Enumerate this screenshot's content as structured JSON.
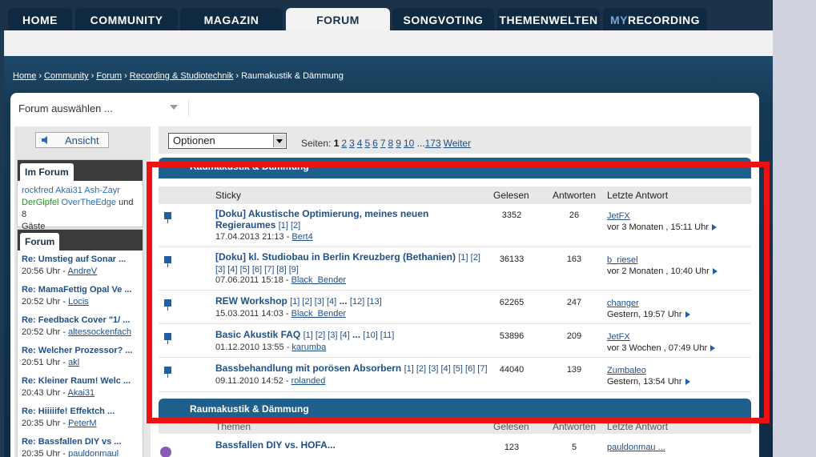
{
  "nav": {
    "tabs": [
      {
        "label": "HOME"
      },
      {
        "label": "COMMUNITY"
      },
      {
        "label": "MAGAZIN"
      },
      {
        "label": "FORUM"
      },
      {
        "label": "SONGVOTING"
      },
      {
        "label": "THEMENWELTEN"
      },
      {
        "prefix": "My",
        "label": "RECORDING"
      }
    ],
    "active": "FORUM"
  },
  "breadcrumb": {
    "items": [
      "Home",
      "Community",
      "Forum",
      "Recording & Studiotechnik"
    ],
    "current": "Raumakustik & Dämmung",
    "separator": "›"
  },
  "forum_select": {
    "label": "Forum auswählen ..."
  },
  "sidebar": {
    "ansicht_label": "Ansicht",
    "im_forum": {
      "title": "Im Forum",
      "users_line1": "rockfred Akai31 Ash-Zayr",
      "user_green": "DerGipfel",
      "user_after": "OverTheEdge",
      "and_text": "und 8",
      "guests": "Gäste"
    },
    "forum_box": {
      "title": "Forum",
      "items": [
        {
          "title": "Re: Umstieg auf Sonar ...",
          "time": "20:56 Uhr -",
          "user": "AndreV"
        },
        {
          "title": "Re: MamaFettig Opal Ve ...",
          "time": "20:52 Uhr -",
          "user": "Locis"
        },
        {
          "title": "Re: Feedback Cover \"1/ ...",
          "time": "20:52 Uhr -",
          "user": "altessockenfach"
        },
        {
          "title": "Re: Welcher Prozessor? ...",
          "time": "20:51 Uhr -",
          "user": "akl"
        },
        {
          "title": "Re: Kleiner Raum! Welc ...",
          "time": "20:43 Uhr -",
          "user": "Akai31"
        },
        {
          "title": "Re: Hiiiiife! Effektch ...",
          "time": "20:35 Uhr -",
          "user": "PeterM"
        },
        {
          "title": "Re: Bassfallen DIY vs ...",
          "time": "20:35 Uhr -",
          "user": "pauldonmaul"
        }
      ]
    }
  },
  "toolbar": {
    "options_label": "Optionen",
    "pages_label": "Seiten:",
    "current_page": "1",
    "pages": [
      "2",
      "3",
      "4",
      "5",
      "6",
      "7",
      "8",
      "9",
      "10"
    ],
    "ellipsis": "...",
    "last_page": "173",
    "next_label": "Weiter"
  },
  "section1": {
    "title": "Raumakustik & Dämmung",
    "columns": {
      "topic": "Sticky",
      "views": "Gelesen",
      "replies": "Antworten",
      "last": "Letzte Antwort"
    },
    "rows": [
      {
        "title_line1": "[Doku] Akustische Optimierung, meines neuen",
        "title_line2": "Regieraumes",
        "pages": "[1] [2]",
        "date": "17.04.2013 21:13 -",
        "author": "Bert4",
        "views": "3352",
        "replies": "26",
        "last_user": "JetFX",
        "last_time": "vor 3 Monaten , 15:11 Uhr"
      },
      {
        "title_line1": "[Doku] kl. Studiobau in Berlin Kreuzberg (Bethanien)",
        "pages_inline": "[1] [2]",
        "pages": "[3] [4] [5] [6] [7] [8] [9]",
        "date": "07.06.2011 15:18 -",
        "author": "Black_Bender",
        "views": "36133",
        "replies": "163",
        "last_user": "b_riesel",
        "last_time": "vor 2 Monaten , 10:40 Uhr"
      },
      {
        "title_line1": "REW Workshop",
        "pages": "[1] [2] [3] [4]",
        "ellipsis": "...",
        "pages_end": "[12] [13]",
        "date": "15.03.2011 14:03 -",
        "author": "Black_Bender",
        "views": "62265",
        "replies": "247",
        "last_user": "changer",
        "last_time": "Gestern, 19:57 Uhr"
      },
      {
        "title_line1": "Basic Akustik FAQ",
        "pages": "[1] [2] [3] [4]",
        "ellipsis": "...",
        "pages_end": "[10] [11]",
        "date": "01.12.2010 13:55 -",
        "author": "karumba",
        "views": "53896",
        "replies": "209",
        "last_user": "JetFX",
        "last_time": "vor 3 Wochen , 07:49 Uhr"
      },
      {
        "title_line1": "Bassbehandlung mit porösen Absorbern",
        "pages": "[1] [2] [3] [4] [5] [6] [7]",
        "date": "09.11.2010 14:52 -",
        "author": "rolanded",
        "views": "44040",
        "replies": "139",
        "last_user": "Zumbaleo",
        "last_time": "Gestern, 13:54 Uhr"
      }
    ]
  },
  "section2": {
    "title": "Raumakustik & Dämmung",
    "columns": {
      "topic": "Themen",
      "views": "Gelesen",
      "replies": "Antworten",
      "last": "Letzte Antwort"
    },
    "rows": [
      {
        "title_line1": "Bassfallen DIY vs. HOFA...",
        "views": "123",
        "replies": "5",
        "last_user": "pauldonmau ..."
      }
    ]
  },
  "colors": {
    "highlight": "#ee1111",
    "accent": "#1f5f8c",
    "link": "#1f4f86"
  }
}
